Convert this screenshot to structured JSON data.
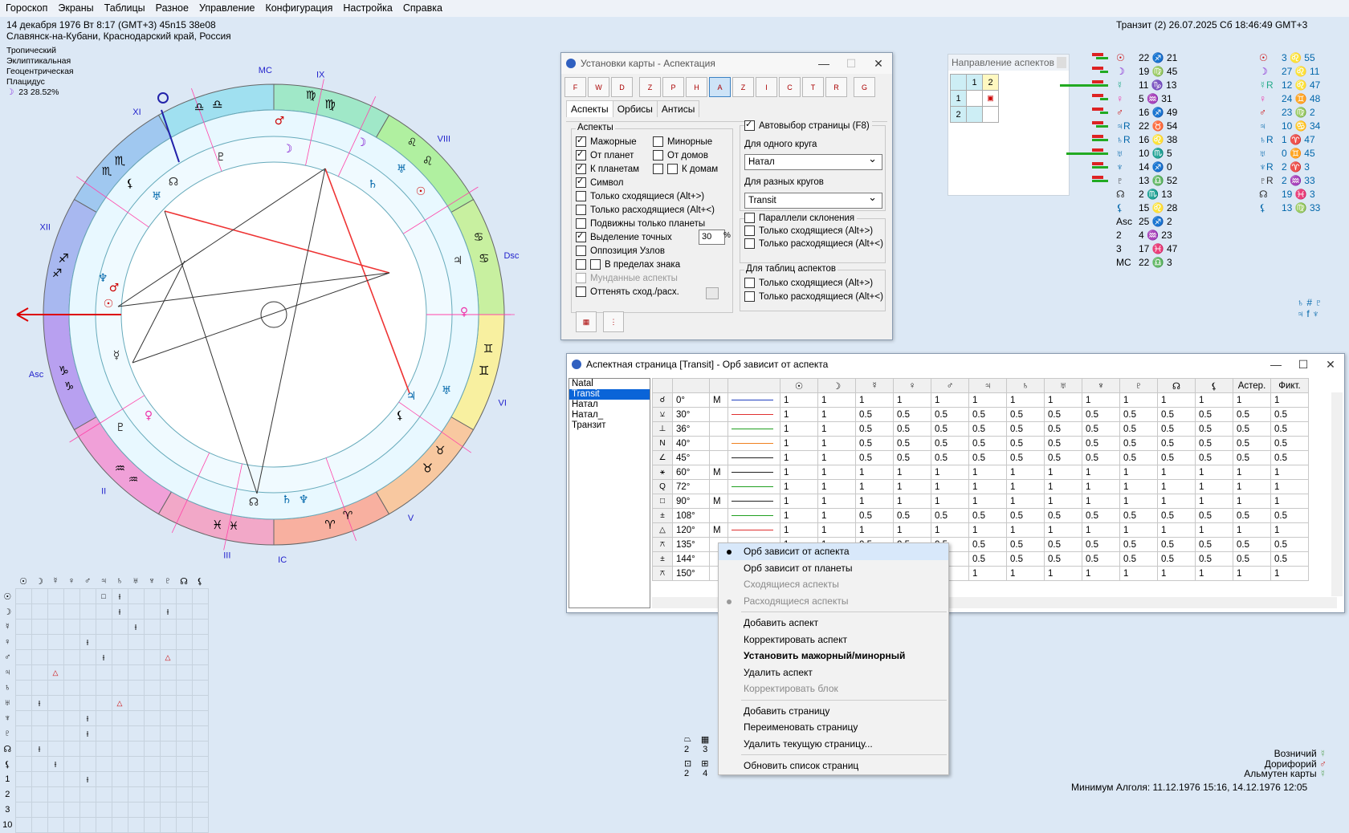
{
  "menu": [
    "Гороскоп",
    "Экраны",
    "Таблицы",
    "Разное",
    "Управление",
    "Конфигурация",
    "Настройка",
    "Справка"
  ],
  "chart_info": {
    "line1": "14 декабря 1976  Вт   8:17 (GMT+3) 45n15  38e08",
    "line2": "Славянск-на-Кубани, Краснодарский край, Россия",
    "zodiac": "Тропический",
    "coords": "Эклиптикальная",
    "center": "Геоцентрическая",
    "houses": "Плацидус",
    "moon_phase": "23 28.52%"
  },
  "transit_header": "Транзит (2) 26.07.2025  Сб 18:46:49 GMT+3",
  "wheel": {
    "houses": [
      "Asc",
      "II",
      "III",
      "IC",
      "V",
      "VI",
      "Dsc",
      "VIII",
      "IX",
      "MC",
      "XI",
      "XII"
    ],
    "signs": [
      "♑",
      "♒",
      "♓",
      "♈",
      "♉",
      "♊",
      "♋",
      "♌",
      "♍",
      "♎",
      "♏",
      "♐"
    ],
    "angles_labels": {
      "asc": "Asc",
      "dsc": "Dsc",
      "mc": "MC",
      "ic": "IC"
    }
  },
  "window_settings": {
    "title": "Установки карты - Аспектация",
    "tools": [
      "F",
      "W",
      "D",
      "Z",
      "P",
      "H",
      "A",
      "Z",
      "I",
      "C",
      "T",
      "R",
      "G"
    ],
    "tabs": [
      "Аспекты",
      "Орбисы",
      "Антисы"
    ],
    "aspects_group": "Аспекты",
    "options_left": [
      {
        "label": "Мажорные",
        "checked": true
      },
      {
        "label": "От планет",
        "checked": true
      },
      {
        "label": "К планетам",
        "checked": true
      },
      {
        "label": "Символ",
        "checked": true
      },
      {
        "label": "Только сходящиеся  (Alt+>)",
        "checked": false
      },
      {
        "label": "Только расходящиеся (Alt+<)",
        "checked": false
      },
      {
        "label": "Подвижны только планеты",
        "checked": false
      },
      {
        "label": "Выделение точных",
        "checked": true
      },
      {
        "label": "Оппозиция Узлов",
        "checked": false
      },
      {
        "label": "В пределах знака",
        "checked": false
      },
      {
        "label": "Мунданные аспекты",
        "checked": false
      },
      {
        "label": "Оттенять сход./расх.",
        "checked": false
      }
    ],
    "exact_value": "30",
    "percent": "%",
    "options_right": [
      {
        "label": "Минорные",
        "checked": false
      },
      {
        "label": "От домов",
        "checked": false
      },
      {
        "label": "К домам",
        "checked": false
      }
    ],
    "autoselect": "Автовыбор страницы  (F8)",
    "one_circle_label": "Для одного круга",
    "one_circle_value": "Натал",
    "diff_circles_label": "Для разных кругов",
    "diff_circles_value": "Transit",
    "parallels": "Параллели склонения",
    "only_conv": "Только сходящиеся  (Alt+>)",
    "only_div": "Только расходящиеся (Alt+<)",
    "tables_group": "Для таблиц аспектов",
    "only_conv2": "Только сходящиеся  (Alt+>)",
    "only_div2": "Только расходящиеся (Alt+<)"
  },
  "direction_panel": {
    "title": "Направление аспектов",
    "cols": [
      "1",
      "2"
    ],
    "rows": [
      "1",
      "2"
    ]
  },
  "aspect_window": {
    "title": "Аспектная страница [Transit] - Орб зависит от аспекта",
    "pages": [
      "Natal",
      "Transit",
      "Натал",
      "Натал_",
      "Транзит"
    ],
    "selected_page": "Transit",
    "headers": [
      "☉",
      "☽",
      "☿",
      "♀",
      "♂",
      "♃",
      "♄",
      "♅",
      "♆",
      "♇",
      "☊",
      "⚸",
      "Астер.",
      "Фикт."
    ],
    "rows": [
      {
        "sym": "☌",
        "deg": "0°",
        "m": "M",
        "color": "#2040c0",
        "vals": [
          "1",
          "1",
          "1",
          "1",
          "1",
          "1",
          "1",
          "1",
          "1",
          "1",
          "1",
          "1",
          "1",
          "1"
        ]
      },
      {
        "sym": "⚺",
        "deg": "30°",
        "m": "",
        "color": "#e03030",
        "vals": [
          "1",
          "1",
          "0.5",
          "0.5",
          "0.5",
          "0.5",
          "0.5",
          "0.5",
          "0.5",
          "0.5",
          "0.5",
          "0.5",
          "0.5",
          "0.5"
        ]
      },
      {
        "sym": "⊥",
        "deg": "36°",
        "m": "",
        "color": "#20a020",
        "vals": [
          "1",
          "1",
          "0.5",
          "0.5",
          "0.5",
          "0.5",
          "0.5",
          "0.5",
          "0.5",
          "0.5",
          "0.5",
          "0.5",
          "0.5",
          "0.5"
        ]
      },
      {
        "sym": "N",
        "deg": "40°",
        "m": "",
        "color": "#f08020",
        "vals": [
          "1",
          "1",
          "0.5",
          "0.5",
          "0.5",
          "0.5",
          "0.5",
          "0.5",
          "0.5",
          "0.5",
          "0.5",
          "0.5",
          "0.5",
          "0.5"
        ]
      },
      {
        "sym": "∠",
        "deg": "45°",
        "m": "",
        "color": "#202020",
        "vals": [
          "1",
          "1",
          "0.5",
          "0.5",
          "0.5",
          "0.5",
          "0.5",
          "0.5",
          "0.5",
          "0.5",
          "0.5",
          "0.5",
          "0.5",
          "0.5"
        ]
      },
      {
        "sym": "⚹",
        "deg": "60°",
        "m": "M",
        "color": "#202020",
        "vals": [
          "1",
          "1",
          "1",
          "1",
          "1",
          "1",
          "1",
          "1",
          "1",
          "1",
          "1",
          "1",
          "1",
          "1"
        ]
      },
      {
        "sym": "Q",
        "deg": "72°",
        "m": "",
        "color": "#20a020",
        "vals": [
          "1",
          "1",
          "1",
          "1",
          "1",
          "1",
          "1",
          "1",
          "1",
          "1",
          "1",
          "1",
          "1",
          "1"
        ]
      },
      {
        "sym": "□",
        "deg": "90°",
        "m": "M",
        "color": "#202020",
        "vals": [
          "1",
          "1",
          "1",
          "1",
          "1",
          "1",
          "1",
          "1",
          "1",
          "1",
          "1",
          "1",
          "1",
          "1"
        ]
      },
      {
        "sym": "±",
        "deg": "108°",
        "m": "",
        "color": "#20a020",
        "vals": [
          "1",
          "1",
          "0.5",
          "0.5",
          "0.5",
          "0.5",
          "0.5",
          "0.5",
          "0.5",
          "0.5",
          "0.5",
          "0.5",
          "0.5",
          "0.5"
        ]
      },
      {
        "sym": "△",
        "deg": "120°",
        "m": "M",
        "color": "#e03030",
        "vals": [
          "1",
          "1",
          "1",
          "1",
          "1",
          "1",
          "1",
          "1",
          "1",
          "1",
          "1",
          "1",
          "1",
          "1"
        ]
      },
      {
        "sym": "⚻",
        "deg": "135°",
        "m": "",
        "color": "#202020",
        "vals": [
          "1",
          "1",
          "0.5",
          "0.5",
          "0.5",
          "0.5",
          "0.5",
          "0.5",
          "0.5",
          "0.5",
          "0.5",
          "0.5",
          "0.5",
          "0.5"
        ]
      },
      {
        "sym": "±",
        "deg": "144°",
        "m": "",
        "color": "#20a020",
        "vals": [
          "1",
          "1",
          "0.5",
          "0.5",
          "0.5",
          "0.5",
          "0.5",
          "0.5",
          "0.5",
          "0.5",
          "0.5",
          "0.5",
          "0.5",
          "0.5"
        ]
      },
      {
        "sym": "⚻",
        "deg": "150°",
        "m": "",
        "color": "#20a020",
        "vals": [
          "1",
          "1",
          "1",
          "1",
          "1",
          "1",
          "1",
          "1",
          "1",
          "1",
          "1",
          "1",
          "1",
          "1"
        ]
      }
    ]
  },
  "context_menu": [
    {
      "label": "Орб зависит от аспекта",
      "state": "radio",
      "disabled": false
    },
    {
      "label": "Орб зависит от планеты",
      "state": "",
      "disabled": false
    },
    {
      "label": "Сходящиеся аспекты",
      "state": "",
      "disabled": true
    },
    {
      "label": "Расходящиеся аспекты",
      "state": "radio-dis",
      "disabled": true
    },
    {
      "sep": true
    },
    {
      "label": "Добавить аспект",
      "state": "",
      "disabled": false
    },
    {
      "label": "Корректировать аспект",
      "state": "",
      "disabled": false
    },
    {
      "label": "Установить мажорный/минорный",
      "state": "bold",
      "disabled": false
    },
    {
      "label": "Удалить аспект",
      "state": "",
      "disabled": false
    },
    {
      "label": "Корректировать блок",
      "state": "",
      "disabled": true
    },
    {
      "sep": true
    },
    {
      "label": "Добавить страницу",
      "state": "",
      "disabled": false
    },
    {
      "label": "Переименовать страницу",
      "state": "",
      "disabled": false
    },
    {
      "label": "Удалить текущую страницу...",
      "state": "",
      "disabled": false
    },
    {
      "sep": true
    },
    {
      "label": "Обновить список страниц",
      "state": "",
      "disabled": false
    }
  ],
  "planets_natal": [
    {
      "g": "☉",
      "v": "22 ♐ 21"
    },
    {
      "g": "☽",
      "v": "19 ♍ 45"
    },
    {
      "g": "☿",
      "v": "11 ♑ 13"
    },
    {
      "g": "♀",
      "v": "5 ♒ 31"
    },
    {
      "g": "♂",
      "v": "16 ♐ 49"
    },
    {
      "g": "♃R",
      "v": "22 ♉ 54"
    },
    {
      "g": "♄R",
      "v": "16 ♌ 38"
    },
    {
      "g": "♅",
      "v": "10 ♏ 5"
    },
    {
      "g": "♆",
      "v": "14 ♐ 0"
    },
    {
      "g": "♇",
      "v": "13 ♎ 52"
    },
    {
      "g": "☊",
      "v": "2 ♏ 13"
    },
    {
      "g": "⚸",
      "v": "15 ♌ 28"
    },
    {
      "g": "Asc",
      "v": "25 ♐ 2"
    },
    {
      "g": "2",
      "v": "4 ♒ 23"
    },
    {
      "g": "3",
      "v": "17 ♓ 47"
    },
    {
      "g": "MC",
      "v": "22 ♎ 3"
    }
  ],
  "planets_transit": [
    {
      "g": "☉",
      "v": "3 ♌ 55"
    },
    {
      "g": "☽",
      "v": "27 ♌ 11"
    },
    {
      "g": "☿R",
      "v": "12 ♌ 47"
    },
    {
      "g": "♀",
      "v": "24 ♊ 48"
    },
    {
      "g": "♂",
      "v": "23 ♍ 2"
    },
    {
      "g": "♃",
      "v": "10 ♋ 34"
    },
    {
      "g": "♄R",
      "v": "1 ♈ 47"
    },
    {
      "g": "♅",
      "v": "0 ♊ 45"
    },
    {
      "g": "♆R",
      "v": "2 ♈ 3"
    },
    {
      "g": "♇R",
      "v": "2 ♒ 33"
    },
    {
      "g": "☊",
      "v": "19 ♓ 3"
    },
    {
      "g": "⚸",
      "v": "13 ♍ 33"
    }
  ],
  "bottom_right": {
    "vozn": "Возничий",
    "dorif": "Дорифорий",
    "almuten": "Альмутен карты",
    "algol": "Минимум Алголя: 11.12.1976 15:16,  14.12.1976 12:05"
  },
  "mini_counts": [
    "2",
    "3",
    "2",
    "4"
  ],
  "bottom_grid_headers": [
    "☉",
    "☽",
    "☿",
    "♀",
    "♂",
    "♃",
    "♄",
    "♅",
    "♆",
    "♇",
    "☊",
    "⚸"
  ],
  "bottom_grid_rows": [
    "☉",
    "☽",
    "☿",
    "♀",
    "♂",
    "♃",
    "♄",
    "♅",
    "♆",
    "♇",
    "☊",
    "⚸",
    "1",
    "2",
    "3",
    "10"
  ]
}
